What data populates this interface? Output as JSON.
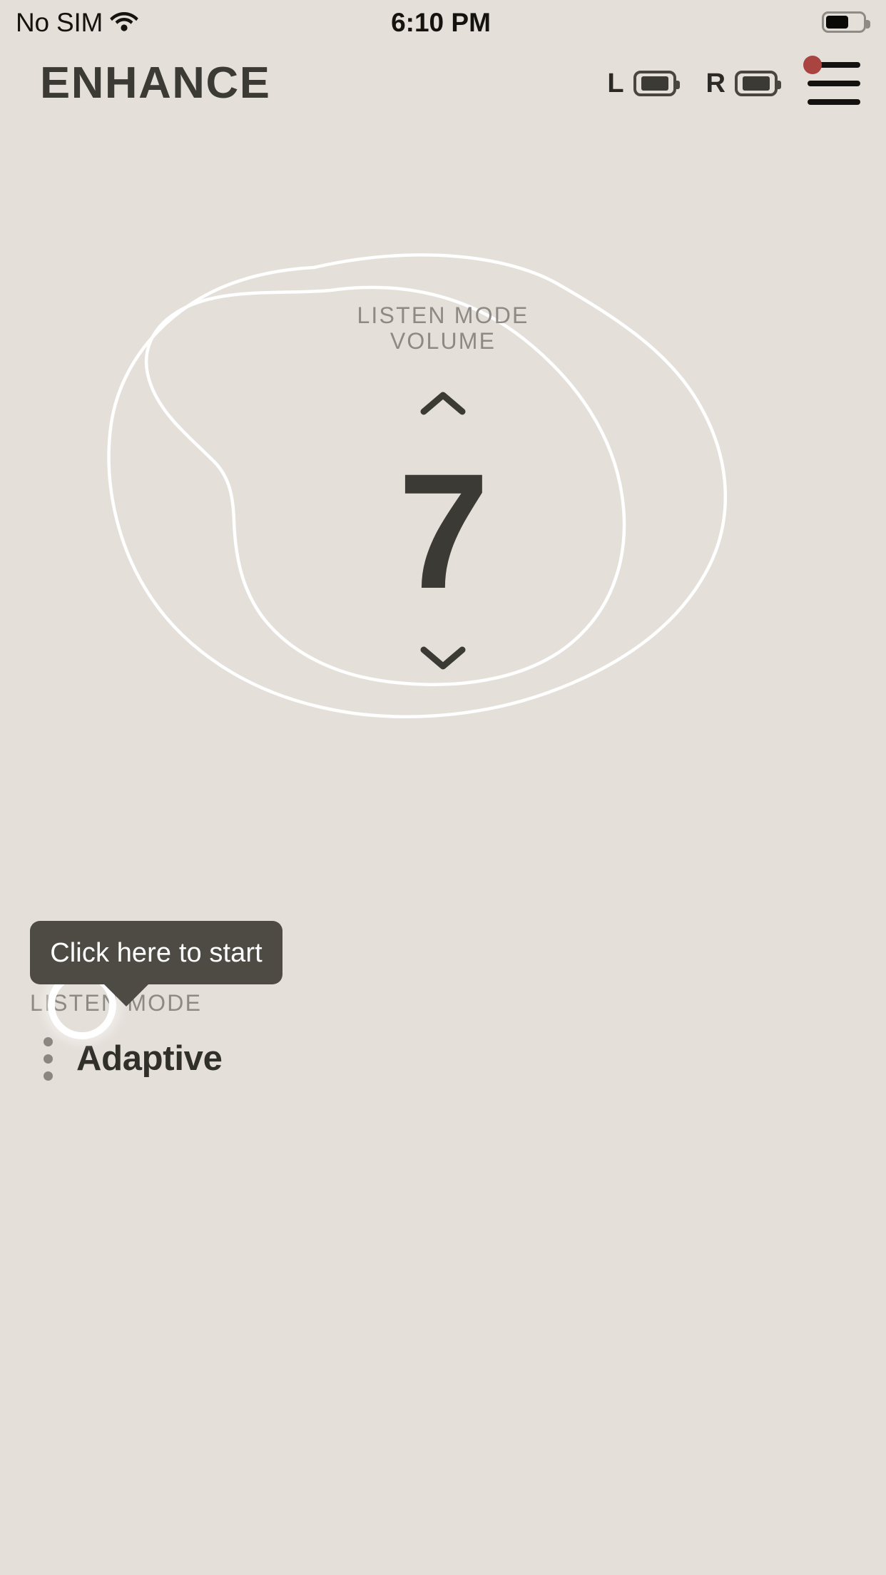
{
  "status_bar": {
    "carrier": "No SIM",
    "wifi_icon": "wifi-icon",
    "time": "6:10 PM",
    "battery_icon": "battery-icon",
    "battery_level_percent": 55
  },
  "header": {
    "brand": "ENHANCE",
    "left_device": {
      "label": "L",
      "battery_icon": "battery-icon",
      "battery_level_percent": 85
    },
    "right_device": {
      "label": "R",
      "battery_icon": "battery-icon",
      "battery_level_percent": 85
    },
    "menu": {
      "icon": "hamburger-menu-icon",
      "notification_dot_color": "#A94440",
      "has_notification": true
    }
  },
  "dial": {
    "title_line1": "LISTEN MODE",
    "title_line2": "VOLUME",
    "increase_icon": "chevron-up-icon",
    "decrease_icon": "chevron-down-icon",
    "volume_value": "7"
  },
  "tooltip": {
    "text": "Click here to start",
    "background_color": "#4E4B45",
    "text_color": "#FFFFFF"
  },
  "listen_mode": {
    "label": "LISTEN MODE",
    "menu_icon": "more-vertical-icon",
    "value": "Adaptive"
  },
  "colors": {
    "background": "#E4DFD9",
    "text_dark": "#3C3A35",
    "text_muted": "#8D8984",
    "outline_white": "#FFFFFF",
    "accent_red": "#A94440"
  }
}
